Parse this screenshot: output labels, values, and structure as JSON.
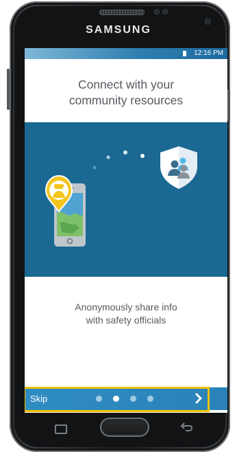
{
  "device": {
    "brand": "SAMSUNG"
  },
  "status_bar": {
    "time": "12:16 PM",
    "battery_icon": "battery-icon"
  },
  "onboarding": {
    "title_line1": "Connect with your",
    "title_line2": "community resources",
    "subtitle_line1": "Anonymously share info",
    "subtitle_line2": "with safety officials",
    "illustration_icons": [
      "phone-icon",
      "anonymous-user-pin-icon",
      "shield-community-icon"
    ]
  },
  "bottom_bar": {
    "skip_label": "Skip",
    "page_count": 4,
    "current_page": 2,
    "next_icon": "chevron-right-icon"
  },
  "colors": {
    "screen_blue": "#1b6893",
    "bar_blue": "#2f8dc2",
    "highlight": "#f2c200",
    "pin_yellow": "#f4c51d"
  }
}
